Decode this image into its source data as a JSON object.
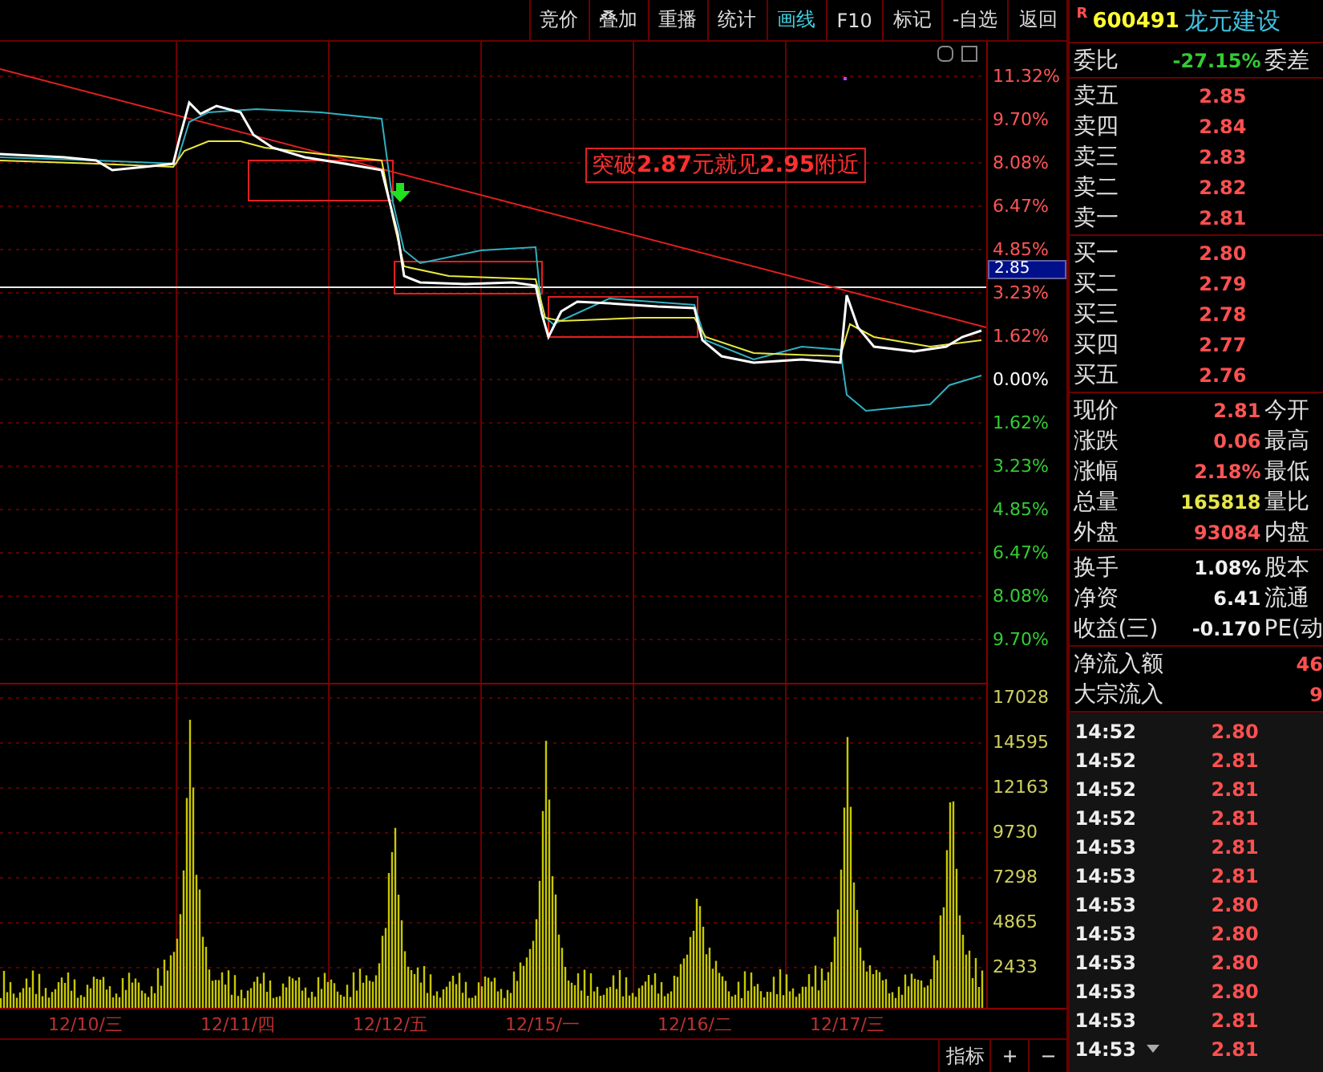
{
  "toolbar": [
    {
      "label": "竞价",
      "selected": false
    },
    {
      "label": "叠加",
      "selected": false
    },
    {
      "label": "重播",
      "selected": false
    },
    {
      "label": "统计",
      "selected": false
    },
    {
      "label": "画线",
      "selected": true
    },
    {
      "label": "F10",
      "selected": false
    },
    {
      "label": "标记",
      "selected": false
    },
    {
      "label": "-自选",
      "selected": false
    },
    {
      "label": "返回",
      "selected": false
    }
  ],
  "stock": {
    "flag": "R",
    "code": "600491",
    "name": "龙元建设"
  },
  "ratio": {
    "label": "委比",
    "value": "-27.15%",
    "label2": "委差"
  },
  "asks": [
    {
      "label": "卖五",
      "price": "2.85"
    },
    {
      "label": "卖四",
      "price": "2.84"
    },
    {
      "label": "卖三",
      "price": "2.83"
    },
    {
      "label": "卖二",
      "price": "2.82"
    },
    {
      "label": "卖一",
      "price": "2.81"
    }
  ],
  "bids": [
    {
      "label": "买一",
      "price": "2.80"
    },
    {
      "label": "买二",
      "price": "2.79"
    },
    {
      "label": "买三",
      "price": "2.78"
    },
    {
      "label": "买四",
      "price": "2.77"
    },
    {
      "label": "买五",
      "price": "2.76"
    }
  ],
  "quotes": [
    {
      "label": "现价",
      "value": "2.81",
      "label2": "今开",
      "color": "#ff5555"
    },
    {
      "label": "涨跌",
      "value": "0.06",
      "label2": "最高",
      "color": "#ff5555"
    },
    {
      "label": "涨幅",
      "value": "2.18%",
      "label2": "最低",
      "color": "#ff5555"
    },
    {
      "label": "总量",
      "value": "165818",
      "label2": "量比",
      "color": "#e6e64a"
    },
    {
      "label": "外盘",
      "value": "93084",
      "label2": "内盘",
      "color": "#ff5555"
    }
  ],
  "fundamentals": [
    {
      "label": "换手",
      "value": "1.08%",
      "label2": "股本"
    },
    {
      "label": "净资",
      "value": "6.41",
      "label2": "流通"
    },
    {
      "label": "收益(三)",
      "value": "-0.170",
      "label2": "PE(动"
    }
  ],
  "flows": [
    {
      "label": "净流入额",
      "value": "46"
    },
    {
      "label": "大宗流入",
      "value": "9"
    }
  ],
  "trades": [
    {
      "time": "14:52",
      "price": "2.80"
    },
    {
      "time": "14:52",
      "price": "2.81"
    },
    {
      "time": "14:52",
      "price": "2.81"
    },
    {
      "time": "14:52",
      "price": "2.81"
    },
    {
      "time": "14:53",
      "price": "2.81"
    },
    {
      "time": "14:53",
      "price": "2.81"
    },
    {
      "time": "14:53",
      "price": "2.80"
    },
    {
      "time": "14:53",
      "price": "2.80"
    },
    {
      "time": "14:53",
      "price": "2.80"
    },
    {
      "time": "14:53",
      "price": "2.80"
    },
    {
      "time": "14:53",
      "price": "2.81"
    },
    {
      "time": "14:53",
      "price": "2.81"
    }
  ],
  "price_axis": [
    {
      "label": "11.32%",
      "color": "#ff5555"
    },
    {
      "label": "9.70%",
      "color": "#ff5555"
    },
    {
      "label": "8.08%",
      "color": "#ff5555"
    },
    {
      "label": "6.47%",
      "color": "#ff5555"
    },
    {
      "label": "4.85%",
      "color": "#ff5555"
    },
    {
      "label": "3.23%",
      "color": "#ff5555"
    },
    {
      "label": "1.62%",
      "color": "#ff5555"
    },
    {
      "label": "0.00%",
      "color": "#ffffff"
    },
    {
      "label": "1.62%",
      "color": "#33cc33"
    },
    {
      "label": "3.23%",
      "color": "#33cc33"
    },
    {
      "label": "4.85%",
      "color": "#33cc33"
    },
    {
      "label": "6.47%",
      "color": "#33cc33"
    },
    {
      "label": "8.08%",
      "color": "#33cc33"
    },
    {
      "label": "9.70%",
      "color": "#33cc33"
    }
  ],
  "volume_axis": [
    "17028",
    "14595",
    "12163",
    "9730",
    "7298",
    "4865",
    "2433"
  ],
  "price_marker": "2.85",
  "annotation": "突破**2.87**元就见**2.95**附近",
  "dates": [
    "12/10/三",
    "12/11/四",
    "12/12/五",
    "12/15/一",
    "12/16/二",
    "12/17/三"
  ],
  "bottom_buttons": [
    "指标",
    "+",
    "−"
  ]
}
